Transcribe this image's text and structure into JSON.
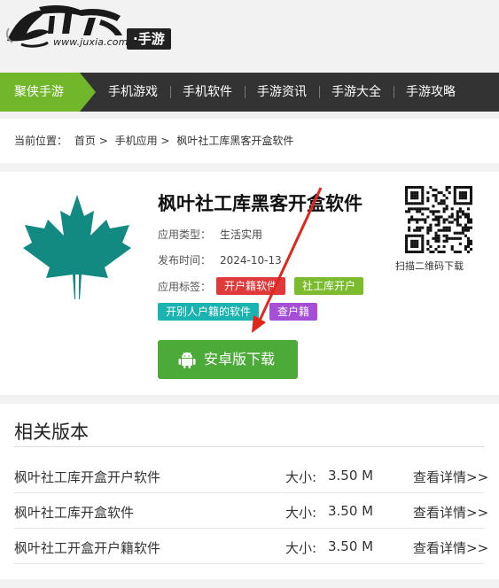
{
  "header": {
    "logo_url": "www.juxia.com",
    "logo_badge": "·手游"
  },
  "nav": {
    "home": "聚侠手游",
    "items": [
      "手机游戏",
      "手机软件",
      "手游资讯",
      "手游大全",
      "手游攻略"
    ]
  },
  "breadcrumb": {
    "label": "当前位置：",
    "items": [
      "首页",
      ">",
      "手机应用",
      ">",
      "枫叶社工库黑客开盒软件"
    ]
  },
  "app": {
    "title": "枫叶社工库黑客开盒软件",
    "type_label": "应用类型：",
    "type_value": "生活实用",
    "date_label": "发布时间：",
    "date_value": "2024-10-13",
    "tags_label": "应用标签：",
    "tags": [
      {
        "text": "开户籍软件",
        "color": "#e0393a"
      },
      {
        "text": "社工库开户",
        "color": "#7dbb2e"
      },
      {
        "text": "开别人户籍的软件",
        "color": "#1ab3b0"
      },
      {
        "text": "查户籍",
        "color": "#a54fd6"
      }
    ],
    "download_label": "安卓版下载",
    "qr_caption": "扫描二维码下载",
    "icon_color": "#128a82",
    "accent_color": "#4caa39"
  },
  "related": {
    "title": "相关版本",
    "rows": [
      {
        "name": "枫叶社工库开盒开户软件",
        "size_label": "大小:",
        "size": "3.50 M",
        "more": "查看详情>>"
      },
      {
        "name": "枫叶社工库开盒软件",
        "size_label": "大小:",
        "size": "3.50 M",
        "more": "查看详情>>"
      },
      {
        "name": "枫叶社工开盒开户籍软件",
        "size_label": "大小:",
        "size": "3.50 M",
        "more": "查看详情>>"
      }
    ]
  }
}
